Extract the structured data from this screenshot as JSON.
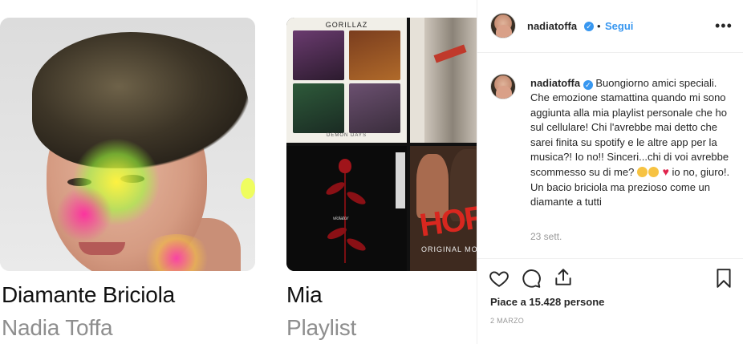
{
  "media": {
    "left_card": {
      "title": "Diamante Briciola",
      "subtitle": "Nadia Toffa"
    },
    "right_card": {
      "title": "Mia",
      "subtitle": "Playlist",
      "albums": {
        "gorillaz_title": "GORILLAZ",
        "gorillaz_subtitle": "DEMON DAYS",
        "depeche_signature": "violator",
        "horror_text": "HOR",
        "horror_sub": "ORIGINAL MOT"
      }
    }
  },
  "post": {
    "username": "nadiatoffa",
    "separator": "•",
    "follow_label": "Segui",
    "more_label": "•••",
    "comment": {
      "author": "nadiatoffa",
      "text_part1": "Buongiorno amici speciali. Che emozione stamattina quando mi sono aggiunta alla mia playlist personale che ho sul cellulare! Chi l'avrebbe mai detto che sarei finita su spotify e le altre app per la musica?! Io no!! Sinceri...chi di voi avrebbe scommesso su di me?",
      "text_part2": "io no, giuro!. Un bacio briciola ma prezioso come un diamante a tutti",
      "time": "23 sett."
    },
    "likes_text": "Piace a 15.428 persone",
    "date": "2 MARZO"
  },
  "colors": {
    "link_blue": "#3897f0",
    "text_dark": "#262626",
    "muted": "#999999",
    "heart_red": "#e0244d"
  },
  "icons": [
    "verified-badge-icon",
    "heart-icon",
    "comment-icon",
    "share-icon",
    "bookmark-icon",
    "more-options-icon"
  ]
}
